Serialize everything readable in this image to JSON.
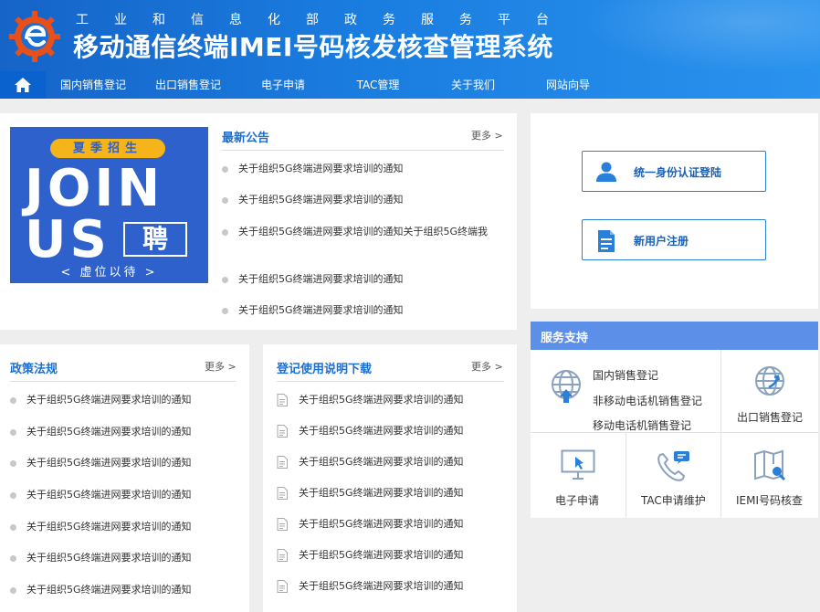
{
  "header": {
    "subtitle": "工业和信息化部政务服务平台",
    "title": "移动通信终端IMEI号码核发核查管理系统"
  },
  "nav": {
    "items": [
      {
        "label": "国内销售登记"
      },
      {
        "label": "出口销售登记"
      },
      {
        "label": "电子申请"
      },
      {
        "label": "TAC管理"
      },
      {
        "label": "关于我们"
      },
      {
        "label": "网站向导"
      }
    ]
  },
  "banner": {
    "tag": "夏季招生",
    "line1": "JOIN",
    "line2": "US",
    "badge": "聘",
    "slogan": "< 虚位以待 >"
  },
  "announcements": {
    "title": "最新公告",
    "more": "更多 >",
    "items": [
      "关于组织5G终端进网要求培训的通知",
      "关于组织5G终端进网要求培训的通知",
      "关于组织5G终端进网要求培训的通知关于组织5G终端我",
      "关于组织5G终端进网要求培训的通知",
      "关于组织5G终端进网要求培训的通知"
    ]
  },
  "login": {
    "sso_label": "统一身份认证登陆",
    "register_label": "新用户注册"
  },
  "policy": {
    "title": "政策法规",
    "more": "更多 >",
    "items": [
      "关于组织5G终端进网要求培训的通知",
      "关于组织5G终端进网要求培训的通知",
      "关于组织5G终端进网要求培训的通知",
      "关于组织5G终端进网要求培训的通知",
      "关于组织5G终端进网要求培训的通知",
      "关于组织5G终端进网要求培训的通知",
      "关于组织5G终端进网要求培训的通知"
    ]
  },
  "downloads": {
    "title": "登记使用说明下载",
    "more": "更多 >",
    "items": [
      "关于组织5G终端进网要求培训的通知",
      "关于组织5G终端进网要求培训的通知",
      "关于组织5G终端进网要求培训的通知",
      "关于组织5G终端进网要求培训的通知",
      "关于组织5G终端进网要求培训的通知",
      "关于组织5G终端进网要求培训的通知",
      "关于组织5G终端进网要求培训的通知"
    ]
  },
  "service": {
    "title": "服务支持",
    "domestic_links": [
      "国内销售登记",
      "非移动电话机销售登记",
      "移动电话机销售登记"
    ],
    "export": "出口销售登记",
    "eapply": "电子申请",
    "tac": "TAC申请维护",
    "imei": "IEMI号码核查"
  },
  "colors": {
    "header": "#1a7de0",
    "nav_home": "#0a62cf",
    "accent": "#1a6fd4",
    "service_head": "#5c8fe8",
    "banner": "#2e61cc",
    "banner_tag": "#f4b41a"
  }
}
